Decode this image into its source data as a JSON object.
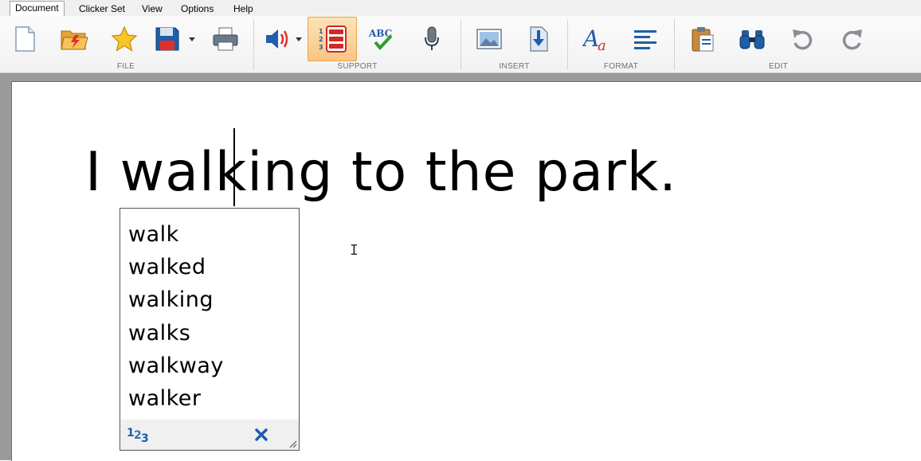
{
  "menu": {
    "items": [
      "Document",
      "Clicker Set",
      "View",
      "Options",
      "Help"
    ],
    "active": "Document"
  },
  "ribbon": {
    "groups": {
      "file": "FILE",
      "support": "SUPPORT",
      "insert": "INSERT",
      "format": "FORMAT",
      "edit": "EDIT"
    },
    "buttons": {
      "file": [
        "new-document-icon",
        "open-folder-icon",
        "favourites-star-icon",
        "save-disk-icon",
        "print-icon"
      ],
      "support": [
        "speech-speaker-icon",
        "word-prediction-icon",
        "spell-check-icon",
        "microphone-icon"
      ],
      "insert": [
        "insert-picture-icon",
        "insert-file-icon"
      ],
      "format": [
        "font-style-icon",
        "align-left-icon"
      ],
      "edit": [
        "paste-clipboard-icon",
        "find-binoculars-icon",
        "undo-icon",
        "redo-icon"
      ]
    },
    "pressed": "word-prediction-icon",
    "accent_color": "#1f5ea8",
    "pressed_bg": "#f9c583"
  },
  "document": {
    "text": "I walking to the park."
  },
  "prediction": {
    "words": [
      "walk",
      "walked",
      "walking",
      "walks",
      "walkway",
      "walker"
    ],
    "numbers_icon": "numbered-list-icon",
    "close_icon": "close-icon"
  }
}
